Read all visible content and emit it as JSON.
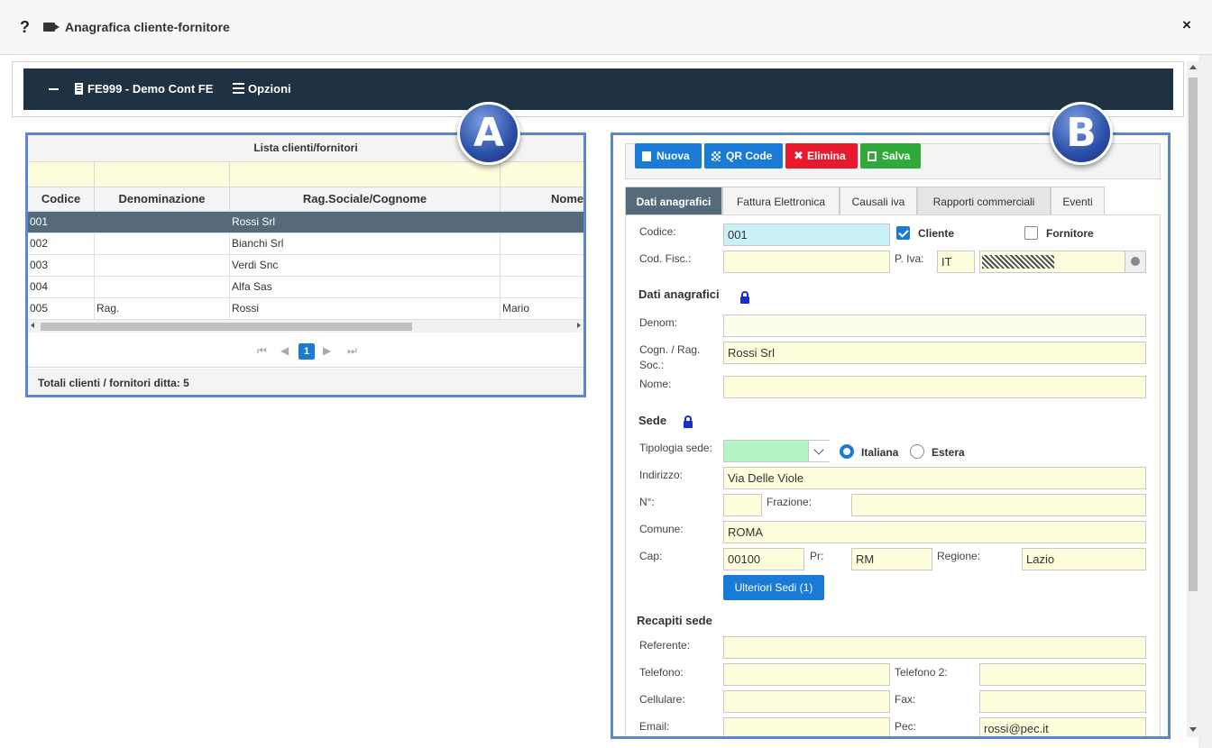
{
  "window": {
    "help": "?",
    "title": "Anagrafica cliente-fornitore",
    "close": "×"
  },
  "navbar": {
    "company": "FE999 - Demo Cont FE",
    "options": "Opzioni"
  },
  "badges": {
    "a": "A",
    "b": "B"
  },
  "grid": {
    "title": "Lista clienti/fornitori",
    "columns": [
      "Codice",
      "Denominazione",
      "Rag.Sociale/Cognome",
      "Nome"
    ],
    "rows": [
      [
        "001",
        "",
        "Rossi Srl",
        ""
      ],
      [
        "002",
        "",
        "Bianchi Srl",
        ""
      ],
      [
        "003",
        "",
        "Verdi Snc",
        ""
      ],
      [
        "004",
        "",
        "Alfa Sas",
        ""
      ],
      [
        "005",
        "Rag.",
        "Rossi",
        "Mario"
      ]
    ],
    "page": "1",
    "footer": "Totali clienti / fornitori ditta: 5"
  },
  "toolbar": {
    "nuova": "Nuova",
    "qrcode": "QR Code",
    "elimina": "Elimina",
    "salva": "Salva"
  },
  "tabs": [
    "Dati anagrafici",
    "Fattura Elettronica",
    "Causali iva",
    "Rapporti commerciali",
    "Eventi"
  ],
  "form": {
    "codice_label": "Codice:",
    "codice": "001",
    "cliente_label": "Cliente",
    "fornitore_label": "Fornitore",
    "codfisc_label": "Cod. Fisc.:",
    "codfisc": "",
    "piva_label": "P. Iva:",
    "piva_country": "IT",
    "dati_section": "Dati anagrafici",
    "denom_label": "Denom:",
    "denom": "",
    "cogn_label1": "Cogn. / Rag.",
    "cogn_label2": "Soc.:",
    "cogn": "Rossi Srl",
    "nome_label": "Nome:",
    "nome": "",
    "sede_section": "Sede",
    "tipologia_label": "Tipologia sede:",
    "italiana_label": "Italiana",
    "estera_label": "Estera",
    "indirizzo_label": "Indirizzo:",
    "indirizzo": "Via Delle Viole",
    "numero_label": "N°:",
    "numero": "",
    "frazione_label": "Frazione:",
    "frazione": "",
    "comune_label": "Comune:",
    "comune": "ROMA",
    "cap_label": "Cap:",
    "cap": "00100",
    "pr_label": "Pr:",
    "pr": "RM",
    "regione_label": "Regione:",
    "regione": "Lazio",
    "ulteriori": "Ulteriori Sedi (1)",
    "recapiti_section": "Recapiti sede",
    "referente_label": "Referente:",
    "referente": "",
    "telefono_label": "Telefono:",
    "telefono": "",
    "telefono2_label": "Telefono 2:",
    "telefono2": "",
    "cellulare_label": "Cellulare:",
    "cellulare": "",
    "fax_label": "Fax:",
    "fax": "",
    "email_label": "Email:",
    "email": "",
    "pec_label": "Pec:",
    "pec": "rossi@pec.it"
  }
}
